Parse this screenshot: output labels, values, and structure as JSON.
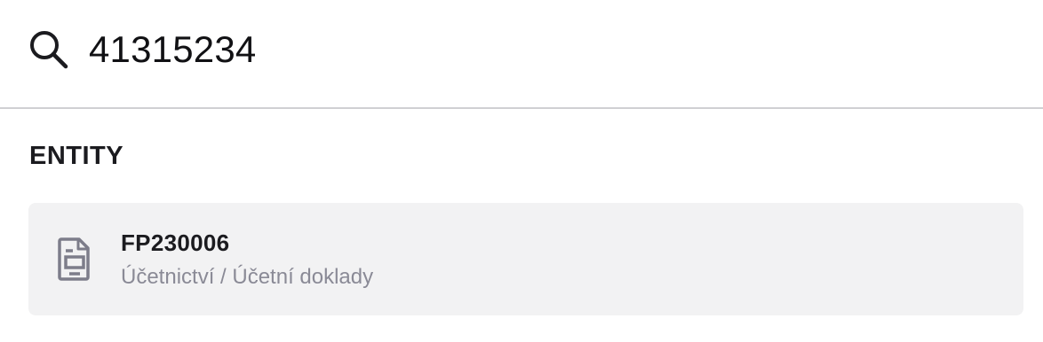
{
  "search": {
    "value": "41315234",
    "icon": "search-icon"
  },
  "section": {
    "title": "ENTITY"
  },
  "results": [
    {
      "title": "FP230006",
      "path": "Účetnictví / Účetní doklady",
      "icon": "document-icon"
    }
  ],
  "colors": {
    "card_background": "#f2f2f3",
    "secondary_text": "#8a8a96",
    "icon": "#7d7d8a",
    "divider": "#d0d0d3"
  }
}
